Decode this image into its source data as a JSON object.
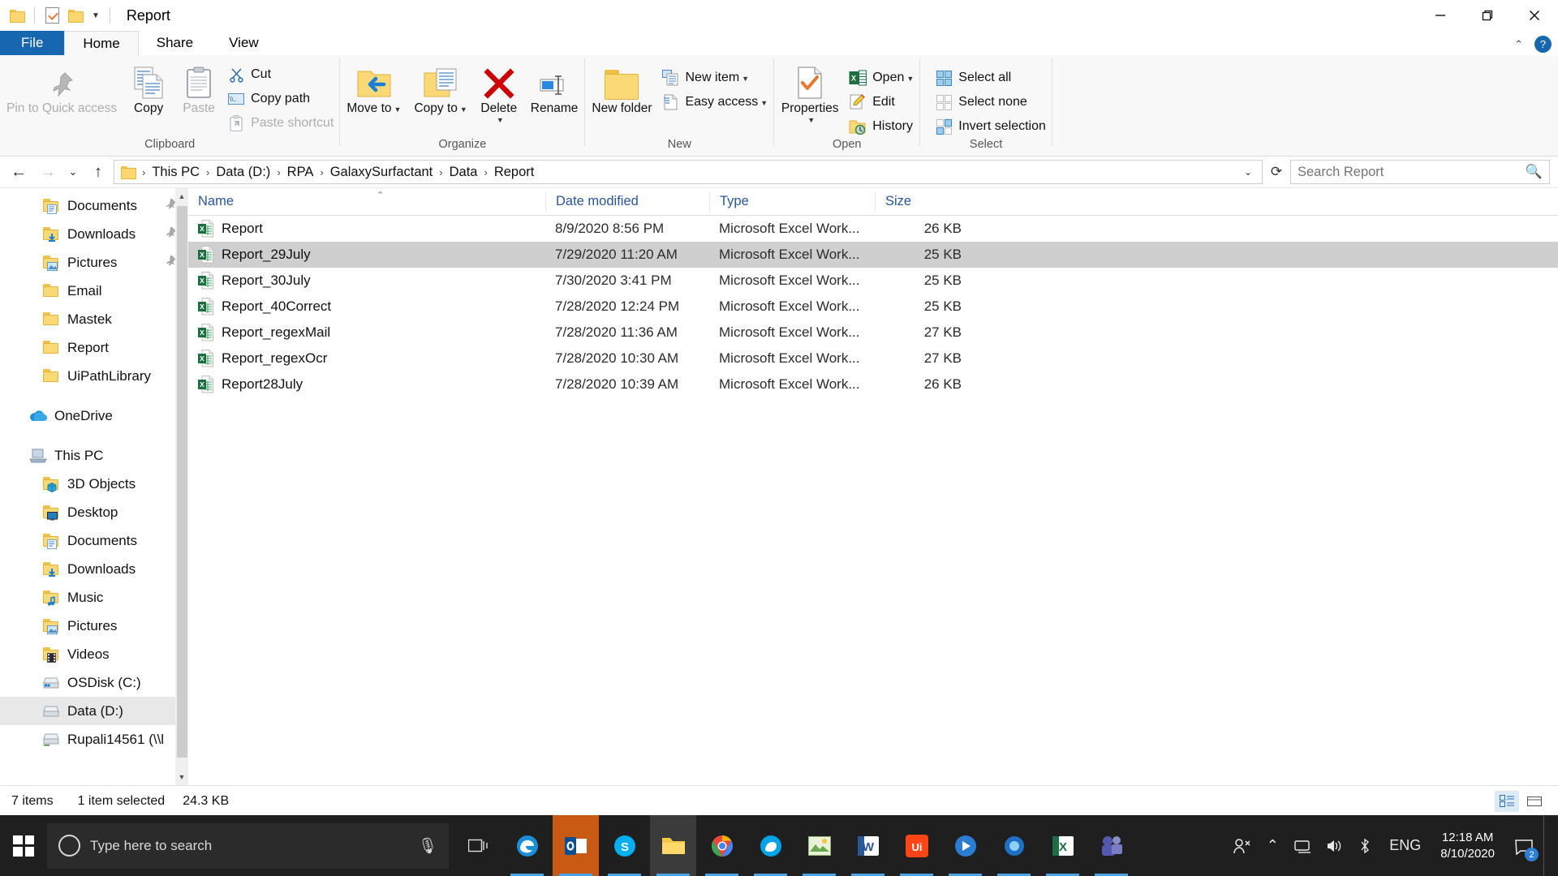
{
  "window": {
    "title": "Report",
    "quick_access": [
      "folder-icon",
      "properties-icon",
      "new-folder-icon",
      "customize-caret"
    ],
    "controls": {
      "minimize": "minimize-icon",
      "restore": "restore-icon",
      "close": "close-icon"
    }
  },
  "tabs": [
    {
      "label": "File",
      "id": "file"
    },
    {
      "label": "Home",
      "id": "home"
    },
    {
      "label": "Share",
      "id": "share"
    },
    {
      "label": "View",
      "id": "view"
    }
  ],
  "active_tab": "Home",
  "ribbon": {
    "groups": [
      {
        "label": "Clipboard",
        "big": [
          {
            "label": "Pin to Quick access",
            "icon": "pin-icon",
            "disabled": true
          },
          {
            "label": "Copy",
            "icon": "copy-icon",
            "disabled": false
          },
          {
            "label": "Paste",
            "icon": "paste-icon",
            "disabled": true
          }
        ],
        "small": [
          {
            "label": "Cut",
            "icon": "scissors-icon",
            "disabled": false
          },
          {
            "label": "Copy path",
            "icon": "copy-path-icon",
            "disabled": false
          },
          {
            "label": "Paste shortcut",
            "icon": "paste-shortcut-icon",
            "disabled": true
          }
        ]
      },
      {
        "label": "Organize",
        "big": [
          {
            "label": "Move to",
            "icon": "move-to-icon",
            "caret": true
          },
          {
            "label": "Copy to",
            "icon": "copy-to-icon",
            "caret": true
          },
          {
            "label": "Delete",
            "icon": "delete-x-icon",
            "caret": true
          },
          {
            "label": "Rename",
            "icon": "rename-icon",
            "caret": false
          }
        ],
        "small": []
      },
      {
        "label": "New",
        "big": [
          {
            "label": "New folder",
            "icon": "new-folder-icon",
            "caret": false
          }
        ],
        "small": [
          {
            "label": "New item",
            "icon": "new-item-icon",
            "caret": true
          },
          {
            "label": "Easy access",
            "icon": "easy-access-icon",
            "caret": true
          }
        ]
      },
      {
        "label": "Open",
        "big": [
          {
            "label": "Properties",
            "icon": "properties-icon",
            "caret": true
          }
        ],
        "small": [
          {
            "label": "Open",
            "icon": "excel-icon",
            "caret": true
          },
          {
            "label": "Edit",
            "icon": "edit-pencil-icon",
            "caret": false
          },
          {
            "label": "History",
            "icon": "history-icon",
            "caret": false
          }
        ]
      },
      {
        "label": "Select",
        "big": [],
        "small": [
          {
            "label": "Select all",
            "icon": "select-all-icon"
          },
          {
            "label": "Select none",
            "icon": "select-none-icon"
          },
          {
            "label": "Invert selection",
            "icon": "invert-selection-icon"
          }
        ]
      }
    ]
  },
  "address": {
    "back": "back-arrow-icon",
    "forward": "forward-arrow-icon",
    "recent": "recent-caret-icon",
    "up": "up-arrow-icon",
    "breadcrumbs": [
      "This PC",
      "Data (D:)",
      "RPA",
      "GalaxySurfactant",
      "Data",
      "Report"
    ],
    "refresh": "refresh-icon"
  },
  "search": {
    "placeholder": "Search Report",
    "value": "",
    "icon": "search-icon"
  },
  "nav": {
    "items": [
      {
        "label": "Documents",
        "icon": "folder-documents-icon",
        "level": 2,
        "pinned": true
      },
      {
        "label": "Downloads",
        "icon": "folder-downloads-icon",
        "level": 2,
        "pinned": true
      },
      {
        "label": "Pictures",
        "icon": "folder-pictures-icon",
        "level": 2,
        "pinned": true
      },
      {
        "label": "Email",
        "icon": "folder-icon",
        "level": 2,
        "pinned": false
      },
      {
        "label": "Mastek",
        "icon": "folder-icon",
        "level": 2,
        "pinned": false
      },
      {
        "label": "Report",
        "icon": "folder-icon",
        "level": 2,
        "pinned": false
      },
      {
        "label": "UiPathLibrary",
        "icon": "folder-icon",
        "level": 2,
        "pinned": false
      },
      {
        "label": "OneDrive",
        "icon": "onedrive-cloud-icon",
        "level": 1,
        "pinned": false,
        "gap": true
      },
      {
        "label": "This PC",
        "icon": "this-pc-icon",
        "level": 1,
        "pinned": false,
        "gap": true
      },
      {
        "label": "3D Objects",
        "icon": "folder-3dobjects-icon",
        "level": 2,
        "pinned": false
      },
      {
        "label": "Desktop",
        "icon": "folder-desktop-icon",
        "level": 2,
        "pinned": false
      },
      {
        "label": "Documents",
        "icon": "folder-documents-icon",
        "level": 2,
        "pinned": false
      },
      {
        "label": "Downloads",
        "icon": "folder-downloads-icon",
        "level": 2,
        "pinned": false
      },
      {
        "label": "Music",
        "icon": "folder-music-icon",
        "level": 2,
        "pinned": false
      },
      {
        "label": "Pictures",
        "icon": "folder-pictures-icon",
        "level": 2,
        "pinned": false
      },
      {
        "label": "Videos",
        "icon": "folder-videos-icon",
        "level": 2,
        "pinned": false
      },
      {
        "label": "OSDisk (C:)",
        "icon": "drive-windows-icon",
        "level": 2,
        "pinned": false
      },
      {
        "label": "Data (D:)",
        "icon": "drive-icon",
        "level": 2,
        "pinned": false,
        "selected": true
      },
      {
        "label": "Rupali14561 (\\\\l",
        "icon": "network-drive-icon",
        "level": 2,
        "pinned": false
      }
    ]
  },
  "filelist": {
    "columns": [
      "Name",
      "Date modified",
      "Type",
      "Size"
    ],
    "sorted_by": "Name",
    "rows": [
      {
        "name": "Report",
        "date": "8/9/2020 8:56 PM",
        "type": "Microsoft Excel Work...",
        "size": "26 KB",
        "icon": "excel-file-icon",
        "selected": false
      },
      {
        "name": "Report_29July",
        "date": "7/29/2020 11:20 AM",
        "type": "Microsoft Excel Work...",
        "size": "25 KB",
        "icon": "excel-file-icon",
        "selected": true
      },
      {
        "name": "Report_30July",
        "date": "7/30/2020 3:41 PM",
        "type": "Microsoft Excel Work...",
        "size": "25 KB",
        "icon": "excel-file-icon",
        "selected": false
      },
      {
        "name": "Report_40Correct",
        "date": "7/28/2020 12:24 PM",
        "type": "Microsoft Excel Work...",
        "size": "25 KB",
        "icon": "excel-file-icon",
        "selected": false
      },
      {
        "name": "Report_regexMail",
        "date": "7/28/2020 11:36 AM",
        "type": "Microsoft Excel Work...",
        "size": "27 KB",
        "icon": "excel-file-icon",
        "selected": false
      },
      {
        "name": "Report_regexOcr",
        "date": "7/28/2020 10:30 AM",
        "type": "Microsoft Excel Work...",
        "size": "27 KB",
        "icon": "excel-file-icon",
        "selected": false
      },
      {
        "name": "Report28July",
        "date": "7/28/2020 10:39 AM",
        "type": "Microsoft Excel Work...",
        "size": "26 KB",
        "icon": "excel-file-icon",
        "selected": false
      }
    ]
  },
  "status": {
    "item_count": "7 items",
    "selection": "1 item selected",
    "selection_size": "24.3 KB",
    "views": [
      {
        "name": "details-view",
        "active": true
      },
      {
        "name": "large-icons-view",
        "active": false
      }
    ]
  },
  "taskbar": {
    "search_placeholder": "Type here to search",
    "apps": [
      {
        "name": "task-view",
        "running": false
      },
      {
        "name": "edge",
        "running": true
      },
      {
        "name": "outlook",
        "running": true
      },
      {
        "name": "skype",
        "running": true
      },
      {
        "name": "file-explorer",
        "running": true
      },
      {
        "name": "chrome",
        "running": true
      },
      {
        "name": "firefox-dev",
        "running": true
      },
      {
        "name": "photos",
        "running": true
      },
      {
        "name": "word",
        "running": true
      },
      {
        "name": "uipath",
        "running": true
      },
      {
        "name": "media-player",
        "running": true
      },
      {
        "name": "blue-app",
        "running": true
      },
      {
        "name": "excel",
        "running": true
      },
      {
        "name": "teams",
        "running": true
      }
    ],
    "tray": {
      "language": "ENG",
      "time": "12:18 AM",
      "date": "8/10/2020",
      "notification_count": "2"
    }
  }
}
